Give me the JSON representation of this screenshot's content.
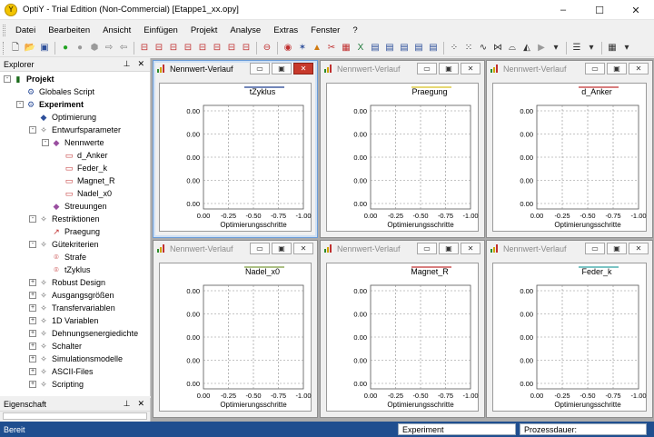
{
  "window": {
    "title": "OptiY - Trial Edition (Non-Commercial) [Etappe1_xx.opy]",
    "app_icon": "optiy-logo-icon",
    "minimize": "–",
    "maximize": "☐",
    "close": "✕"
  },
  "menu": [
    "Datei",
    "Bearbeiten",
    "Ansicht",
    "Einfügen",
    "Projekt",
    "Analyse",
    "Extras",
    "Fenster",
    "?"
  ],
  "toolbar": {
    "buttons": [
      {
        "icon": "new-file-icon",
        "glyph": "🗋",
        "color": "#333333"
      },
      {
        "icon": "open-folder-icon",
        "glyph": "📂",
        "color": "#c89b2a"
      },
      {
        "icon": "save-icon",
        "glyph": "▣",
        "color": "#2d4f9a"
      },
      {
        "icon": "sep"
      },
      {
        "icon": "run-icon",
        "glyph": "●",
        "color": "#23a323"
      },
      {
        "icon": "stop-icon",
        "glyph": "●",
        "color": "#9a9a9a"
      },
      {
        "icon": "pause-icon",
        "glyph": "⬢",
        "color": "#9a9a9a"
      },
      {
        "icon": "step-forward-icon",
        "glyph": "⇨",
        "color": "#777777"
      },
      {
        "icon": "step-back-icon",
        "glyph": "⇦",
        "color": "#777777"
      },
      {
        "icon": "sep"
      },
      {
        "icon": "insert-param-icon",
        "glyph": "⊟",
        "color": "#c03030"
      },
      {
        "icon": "insert-restriction-icon",
        "glyph": "⊟",
        "color": "#c03030"
      },
      {
        "icon": "insert-criterion-icon",
        "glyph": "⊟",
        "color": "#c03030"
      },
      {
        "icon": "insert-output-icon",
        "glyph": "⊟",
        "color": "#c03030"
      },
      {
        "icon": "insert-transfer-icon",
        "glyph": "⊟",
        "color": "#c03030"
      },
      {
        "icon": "insert-variable-icon",
        "glyph": "⊟",
        "color": "#c03030"
      },
      {
        "icon": "insert-model-icon",
        "glyph": "⊟",
        "color": "#c03030"
      },
      {
        "icon": "insert-file-icon",
        "glyph": "⊟",
        "color": "#c03030"
      },
      {
        "icon": "sep"
      },
      {
        "icon": "delete-icon",
        "glyph": "⊖",
        "color": "#c03030"
      },
      {
        "icon": "sep"
      },
      {
        "icon": "target-icon",
        "glyph": "◉",
        "color": "#c03030"
      },
      {
        "icon": "pareto-icon",
        "glyph": "✶",
        "color": "#2d4f9a"
      },
      {
        "icon": "cone-icon",
        "glyph": "▲",
        "color": "#d07a10"
      },
      {
        "icon": "tools-icon",
        "glyph": "✂",
        "color": "#c03030"
      },
      {
        "icon": "matrix-icon",
        "glyph": "▦",
        "color": "#c03030"
      },
      {
        "icon": "excel-icon",
        "glyph": "X",
        "color": "#1e7a3a"
      },
      {
        "icon": "table-icon",
        "glyph": "▤",
        "color": "#2d4f9a"
      },
      {
        "icon": "chart-table-icon",
        "glyph": "▤",
        "color": "#2d4f9a"
      },
      {
        "icon": "chart-table2-icon",
        "glyph": "▤",
        "color": "#2d4f9a"
      },
      {
        "icon": "chart-table3-icon",
        "glyph": "▤",
        "color": "#2d4f9a"
      },
      {
        "icon": "chart-table4-icon",
        "glyph": "▤",
        "color": "#2d4f9a"
      },
      {
        "icon": "sep"
      },
      {
        "icon": "scatter-icon",
        "glyph": "⁘",
        "color": "#333333"
      },
      {
        "icon": "scatter2-icon",
        "glyph": "⁙",
        "color": "#333333"
      },
      {
        "icon": "curve-icon",
        "glyph": "∿",
        "color": "#333333"
      },
      {
        "icon": "surface-icon",
        "glyph": "⋈",
        "color": "#333333"
      },
      {
        "icon": "contour-icon",
        "glyph": "⌓",
        "color": "#333333"
      },
      {
        "icon": "mountain-icon",
        "glyph": "◭",
        "color": "#333333"
      },
      {
        "icon": "play-icon",
        "glyph": "▶",
        "color": "#9a9a9a"
      },
      {
        "icon": "dropdown-icon",
        "glyph": "▾",
        "color": "#333333"
      },
      {
        "icon": "sep"
      },
      {
        "icon": "align-icon",
        "glyph": "☰",
        "color": "#333333"
      },
      {
        "icon": "dropdown2-icon",
        "glyph": "▾",
        "color": "#333333"
      },
      {
        "icon": "sep"
      },
      {
        "icon": "grid-icon",
        "glyph": "▦",
        "color": "#333333"
      },
      {
        "icon": "dropdown3-icon",
        "glyph": "▾",
        "color": "#333333"
      }
    ]
  },
  "explorer": {
    "title": "Explorer",
    "pin": "⊥",
    "close": "✕",
    "tree": [
      {
        "label": "Projekt",
        "level": 0,
        "exp": "-",
        "icon": "project-icon",
        "glyph": "▮",
        "color": "#1a6a1a",
        "bold": true
      },
      {
        "label": "Globales Script",
        "level": 1,
        "exp": "",
        "icon": "script-icon",
        "glyph": "⚙",
        "color": "#2d4f9a",
        "bold": false
      },
      {
        "label": "Experiment",
        "level": 1,
        "exp": "-",
        "icon": "experiment-icon",
        "glyph": "⚙",
        "color": "#2d4f9a",
        "bold": true
      },
      {
        "label": "Optimierung",
        "level": 2,
        "exp": "",
        "icon": "optimization-icon",
        "glyph": "◆",
        "color": "#2d4f9a",
        "bold": false
      },
      {
        "label": "Entwurfsparameter",
        "level": 2,
        "exp": "-",
        "icon": "design-params-icon",
        "glyph": "✧",
        "color": "#555555",
        "bold": false
      },
      {
        "label": "Nennwerte",
        "level": 3,
        "exp": "-",
        "icon": "nominal-values-icon",
        "glyph": "◆",
        "color": "#9a4fa0",
        "bold": false
      },
      {
        "label": "d_Anker",
        "level": 4,
        "exp": "",
        "icon": "param-icon",
        "glyph": "▭",
        "color": "#c03030",
        "bold": false
      },
      {
        "label": "Feder_k",
        "level": 4,
        "exp": "",
        "icon": "param-icon",
        "glyph": "▭",
        "color": "#c03030",
        "bold": false
      },
      {
        "label": "Magnet_R",
        "level": 4,
        "exp": "",
        "icon": "param-icon",
        "glyph": "▭",
        "color": "#c03030",
        "bold": false
      },
      {
        "label": "Nadel_x0",
        "level": 4,
        "exp": "",
        "icon": "param-icon",
        "glyph": "▭",
        "color": "#c03030",
        "bold": false
      },
      {
        "label": "Streuungen",
        "level": 3,
        "exp": "",
        "icon": "scatter-node-icon",
        "glyph": "◆",
        "color": "#9a4fa0",
        "bold": false
      },
      {
        "label": "Restriktionen",
        "level": 2,
        "exp": "-",
        "icon": "restrictions-icon",
        "glyph": "✧",
        "color": "#555555",
        "bold": false
      },
      {
        "label": "Praegung",
        "level": 3,
        "exp": "",
        "icon": "restriction-item-icon",
        "glyph": "↗",
        "color": "#c03030",
        "bold": false
      },
      {
        "label": "Gütekriterien",
        "level": 2,
        "exp": "-",
        "icon": "criteria-icon",
        "glyph": "✧",
        "color": "#555555",
        "bold": false
      },
      {
        "label": "Strafe",
        "level": 3,
        "exp": "",
        "icon": "criterion-item-icon",
        "glyph": "⌾",
        "color": "#c03030",
        "bold": false
      },
      {
        "label": "tZyklus",
        "level": 3,
        "exp": "",
        "icon": "criterion-item-icon",
        "glyph": "⌾",
        "color": "#c03030",
        "bold": false
      },
      {
        "label": "Robust Design",
        "level": 2,
        "exp": "+",
        "icon": "robust-design-icon",
        "glyph": "✧",
        "color": "#555555",
        "bold": false
      },
      {
        "label": "Ausgangsgrößen",
        "level": 2,
        "exp": "+",
        "icon": "outputs-icon",
        "glyph": "✧",
        "color": "#555555",
        "bold": false
      },
      {
        "label": "Transfervariablen",
        "level": 2,
        "exp": "+",
        "icon": "transfer-vars-icon",
        "glyph": "✧",
        "color": "#555555",
        "bold": false
      },
      {
        "label": "1D Variablen",
        "level": 2,
        "exp": "+",
        "icon": "1d-vars-icon",
        "glyph": "✧",
        "color": "#555555",
        "bold": false
      },
      {
        "label": "Dehnungsenergiedichte",
        "level": 2,
        "exp": "+",
        "icon": "strain-energy-icon",
        "glyph": "✧",
        "color": "#555555",
        "bold": false
      },
      {
        "label": "Schalter",
        "level": 2,
        "exp": "+",
        "icon": "switch-icon",
        "glyph": "✧",
        "color": "#555555",
        "bold": false
      },
      {
        "label": "Simulationsmodelle",
        "level": 2,
        "exp": "+",
        "icon": "sim-models-icon",
        "glyph": "✧",
        "color": "#555555",
        "bold": false
      },
      {
        "label": "ASCII-Files",
        "level": 2,
        "exp": "+",
        "icon": "ascii-files-icon",
        "glyph": "✧",
        "color": "#555555",
        "bold": false
      },
      {
        "label": "Scripting",
        "level": 2,
        "exp": "+",
        "icon": "scripting-icon",
        "glyph": "✧",
        "color": "#555555",
        "bold": false
      }
    ]
  },
  "properties": {
    "title": "Eigenschaft",
    "pin": "⊥",
    "close": "✕"
  },
  "charts": [
    {
      "window_title": "Nennwert-Verlauf",
      "active": true,
      "chart_data": {
        "type": "line",
        "title": "tZyklus",
        "legend_color": "#1f3f8f",
        "xlabel": "Optimierungsschritte",
        "x_ticks": [
          "0.00",
          "-0.25",
          "-0.50",
          "-0.75",
          "-1.00"
        ],
        "y_ticks": [
          "0.00",
          "0.00",
          "0.00",
          "0.00",
          "0.00"
        ],
        "grid": true,
        "series": []
      }
    },
    {
      "window_title": "Nennwert-Verlauf",
      "active": false,
      "chart_data": {
        "type": "line",
        "title": "Praegung",
        "legend_color": "#d8c020",
        "xlabel": "Optimierungsschritte",
        "x_ticks": [
          "0.00",
          "-0.25",
          "-0.50",
          "-0.75",
          "-1.00"
        ],
        "y_ticks": [
          "0.00",
          "0.00",
          "0.00",
          "0.00",
          "0.00"
        ],
        "grid": true,
        "series": []
      }
    },
    {
      "window_title": "Nennwert-Verlauf",
      "active": false,
      "chart_data": {
        "type": "line",
        "title": "d_Anker",
        "legend_color": "#c03030",
        "xlabel": "Optimierungsschritte",
        "x_ticks": [
          "0.00",
          "-0.25",
          "-0.50",
          "-0.75",
          "-1.00"
        ],
        "y_ticks": [
          "0.00",
          "0.00",
          "0.00",
          "0.00",
          "0.00"
        ],
        "grid": true,
        "series": []
      }
    },
    {
      "window_title": "Nennwert-Verlauf",
      "active": false,
      "chart_data": {
        "type": "line",
        "title": "Nadel_x0",
        "legend_color": "#7a9a3a",
        "xlabel": "Optimierungsschritte",
        "x_ticks": [
          "0.00",
          "-0.25",
          "-0.50",
          "-0.75",
          "-1.00"
        ],
        "y_ticks": [
          "0.00",
          "0.00",
          "0.00",
          "0.00",
          "0.00"
        ],
        "grid": true,
        "series": []
      }
    },
    {
      "window_title": "Nennwert-Verlauf",
      "active": false,
      "chart_data": {
        "type": "line",
        "title": "Magnet_R",
        "legend_color": "#c03030",
        "xlabel": "Optimierungsschritte",
        "x_ticks": [
          "0.00",
          "-0.25",
          "-0.50",
          "-0.75",
          "-1.00"
        ],
        "y_ticks": [
          "0.00",
          "0.00",
          "0.00",
          "0.00",
          "0.00"
        ],
        "grid": true,
        "series": []
      }
    },
    {
      "window_title": "Nennwert-Verlauf",
      "active": false,
      "chart_data": {
        "type": "line",
        "title": "Feder_k",
        "legend_color": "#2aa0a0",
        "xlabel": "Optimierungsschritte",
        "x_ticks": [
          "0.00",
          "-0.25",
          "-0.50",
          "-0.75",
          "-1.00"
        ],
        "y_ticks": [
          "0.00",
          "0.00",
          "0.00",
          "0.00",
          "0.00"
        ],
        "grid": true,
        "series": []
      }
    }
  ],
  "chart_window_buttons": {
    "minimize": "▭",
    "maximize": "▣",
    "close": "✕"
  },
  "status": {
    "ready": "Bereit",
    "experiment": "Experiment",
    "duration_label": "Prozessdauer:"
  }
}
